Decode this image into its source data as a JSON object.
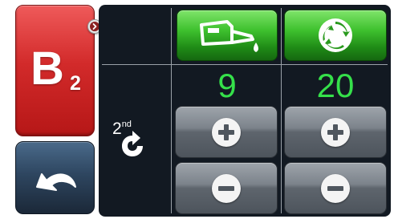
{
  "left_panel": {
    "bank_letter": "B",
    "bank_number": "2",
    "expand_icon": "chevron-right-icon",
    "back_icon": "undo-arrow-icon"
  },
  "columns": {
    "oil": {
      "icon": "oil-can-icon",
      "value": "9"
    },
    "cycle": {
      "icon": "cycle-arrows-icon",
      "value": "20"
    }
  },
  "row_label": {
    "text": "2",
    "suffix": "nd",
    "icon": "refresh-arrow-icon"
  },
  "colors": {
    "bank_red": "#d22a2a",
    "green_button": "#3ec12e",
    "value_green": "#35e04a",
    "panel_bg": "#121922",
    "back_blue": "#2e4660"
  }
}
